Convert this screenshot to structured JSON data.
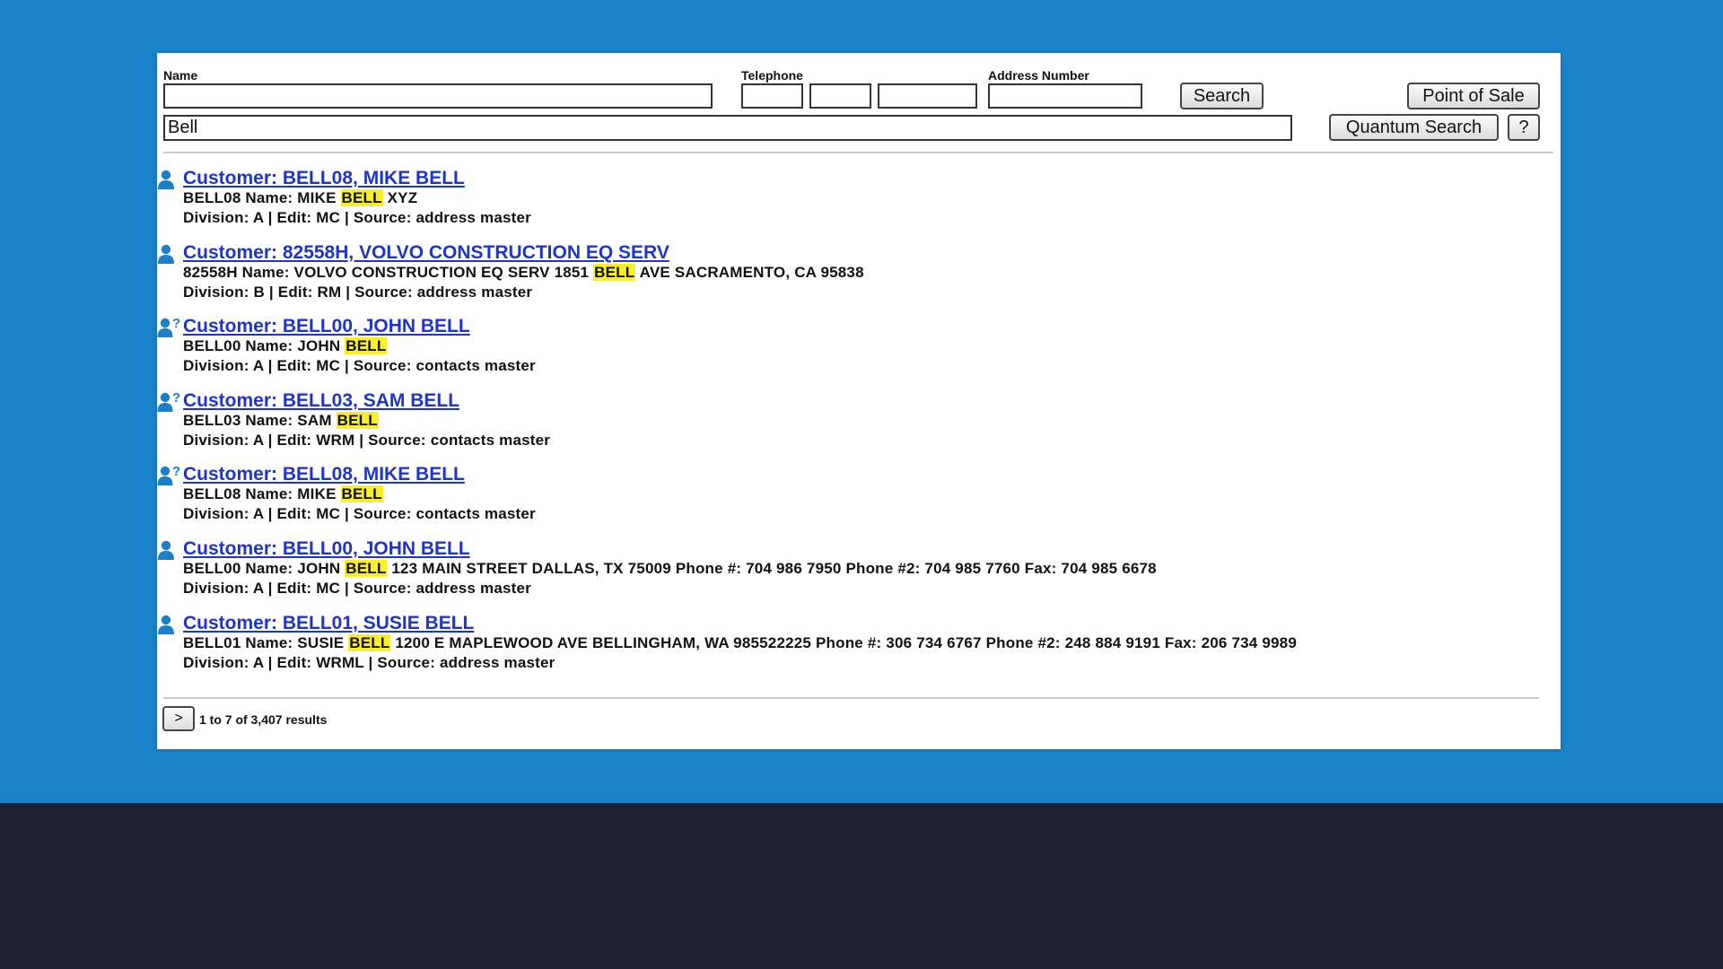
{
  "form": {
    "name_label": "Name",
    "name_value": "",
    "telephone_label": "Telephone",
    "phone_area": "",
    "phone_prefix": "",
    "phone_line": "",
    "address_label": "Address Number",
    "address_value": "",
    "search_label": "Search",
    "pos_label": "Point of Sale",
    "quantum_value": "Bell",
    "quantum_label": "Quantum Search",
    "help_label": "?"
  },
  "results": [
    {
      "icon": "person-icon",
      "title": "Customer: BELL08, MIKE BELL",
      "line1_pre": "BELL08 Name: MIKE ",
      "highlight": "BELL",
      "line1_post": " XYZ",
      "line2": "Division: A | Edit: MC | Source: address master"
    },
    {
      "icon": "person-icon",
      "title": "Customer: 82558H, VOLVO CONSTRUCTION EQ SERV",
      "line1_pre": "82558H Name: VOLVO CONSTRUCTION EQ SERV 1851 ",
      "highlight": "BELL",
      "line1_post": " AVE SACRAMENTO, CA 95838",
      "line2": "Division: B | Edit: RM | Source: address master"
    },
    {
      "icon": "person-question-icon",
      "title": "Customer: BELL00, JOHN BELL",
      "line1_pre": "BELL00 Name: JOHN ",
      "highlight": "BELL",
      "line1_post": "",
      "line2": "Division: A | Edit: MC | Source: contacts master"
    },
    {
      "icon": "person-question-icon",
      "title": "Customer: BELL03, SAM BELL",
      "line1_pre": "BELL03 Name: SAM ",
      "highlight": "BELL",
      "line1_post": "",
      "line2": "Division: A | Edit: WRM | Source: contacts master"
    },
    {
      "icon": "person-question-icon",
      "title": "Customer: BELL08, MIKE BELL",
      "line1_pre": "BELL08 Name: MIKE ",
      "highlight": "BELL",
      "line1_post": "",
      "line2": "Division: A | Edit: MC | Source: contacts master"
    },
    {
      "icon": "person-icon",
      "title": "Customer: BELL00, JOHN BELL",
      "line1_pre": "BELL00 Name: JOHN ",
      "highlight": "BELL",
      "line1_post": " 123 MAIN STREET DALLAS, TX 75009 Phone #: 704 986 7950 Phone #2: 704 985 7760 Fax: 704 985 6678",
      "line2": "Division: A | Edit: MC | Source: address master"
    },
    {
      "icon": "person-icon",
      "title": "Customer: BELL01, SUSIE BELL",
      "line1_pre": "BELL01 Name: SUSIE ",
      "highlight": "BELL",
      "line1_post": " 1200 E MAPLEWOOD AVE BELLINGHAM, WA 985522225 Phone #: 306 734 6767 Phone #2: 248 884 9191 Fax: 206 734 9989",
      "line2": "Division: A | Edit: WRML | Source: address master"
    }
  ],
  "pager": {
    "next_label": ">",
    "summary": "1 to 7 of 3,407 results"
  },
  "colors": {
    "background_top": "#1a82c8",
    "background_bottom": "#1c222f",
    "link": "#1f35c7",
    "highlight": "#f8ef2a",
    "icon": "#1e7fc9"
  }
}
